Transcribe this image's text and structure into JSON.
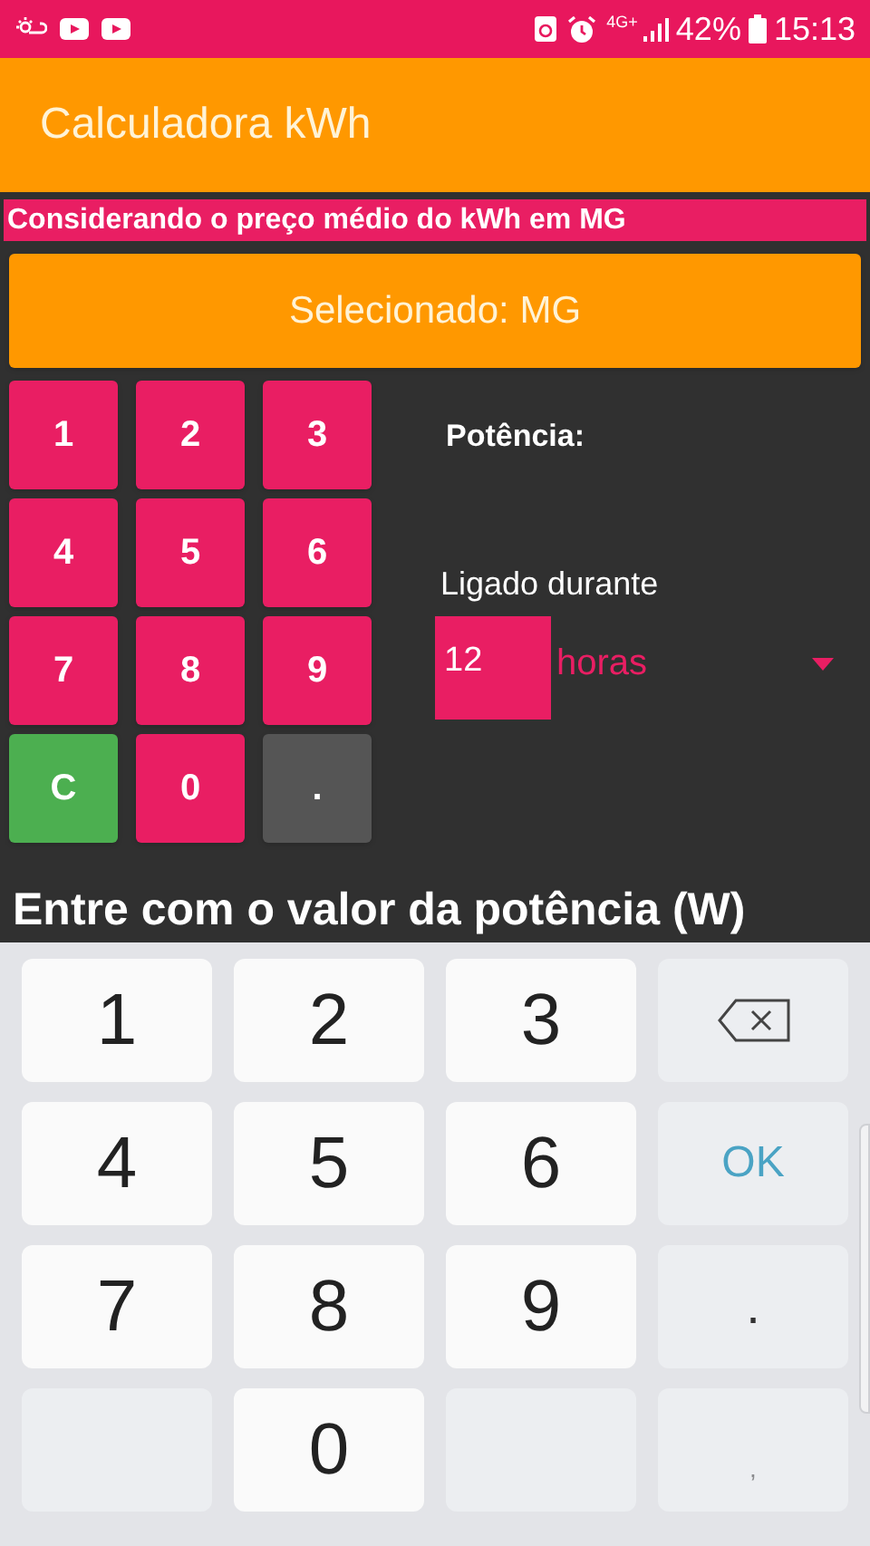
{
  "status_bar": {
    "network": "4G+",
    "battery": "42%",
    "time": "15:13"
  },
  "app_bar": {
    "title": "Calculadora kWh"
  },
  "banner": "Considerando o preço médio do kWh em MG",
  "region_button": "Selecionado: MG",
  "keypad": [
    {
      "kind": "digit",
      "label": "1"
    },
    {
      "kind": "digit",
      "label": "2"
    },
    {
      "kind": "digit",
      "label": "3"
    },
    {
      "kind": "digit",
      "label": "4"
    },
    {
      "kind": "digit",
      "label": "5"
    },
    {
      "kind": "digit",
      "label": "6"
    },
    {
      "kind": "digit",
      "label": "7"
    },
    {
      "kind": "digit",
      "label": "8"
    },
    {
      "kind": "digit",
      "label": "9"
    },
    {
      "kind": "clear",
      "label": "C"
    },
    {
      "kind": "digit",
      "label": "0"
    },
    {
      "kind": "dot",
      "label": "."
    }
  ],
  "power_label": "Potência:",
  "duration_label": "Ligado durante",
  "hours_field": {
    "value": "12"
  },
  "unit_dropdown": {
    "value": "horas"
  },
  "prompt": "Entre com o valor da potência (W)",
  "keyboard": [
    {
      "kind": "digit",
      "label": "1"
    },
    {
      "kind": "digit",
      "label": "2"
    },
    {
      "kind": "digit",
      "label": "3"
    },
    {
      "kind": "backspace"
    },
    {
      "kind": "digit",
      "label": "4"
    },
    {
      "kind": "digit",
      "label": "5"
    },
    {
      "kind": "digit",
      "label": "6"
    },
    {
      "kind": "ok",
      "label": "OK"
    },
    {
      "kind": "digit",
      "label": "7"
    },
    {
      "kind": "digit",
      "label": "8"
    },
    {
      "kind": "digit",
      "label": "9"
    },
    {
      "kind": "symbol",
      "label": "."
    },
    {
      "kind": "blank"
    },
    {
      "kind": "digit",
      "label": "0"
    },
    {
      "kind": "blank"
    },
    {
      "kind": "faint",
      "label": ","
    }
  ]
}
